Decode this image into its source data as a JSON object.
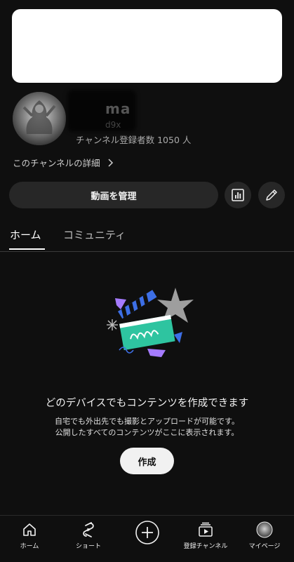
{
  "channel": {
    "name_partial": "ma",
    "handle_partial": "d9x",
    "subscribers": "チャンネル登録者数 1050 人",
    "details_link": "このチャンネルの詳細"
  },
  "actions": {
    "manage_label": "動画を管理",
    "analytics_icon": "analytics-icon",
    "edit_icon": "pencil-icon"
  },
  "tabs": [
    {
      "label": "ホーム",
      "active": true
    },
    {
      "label": "コミュニティ",
      "active": false
    }
  ],
  "empty_state": {
    "title": "どのデバイスでもコンテンツを作成できます",
    "line1": "自宅でも外出先でも撮影とアップロードが可能です。",
    "line2": "公開したすべてのコンテンツがここに表示されます。",
    "create_label": "作成"
  },
  "bottom_nav": [
    {
      "label": "ホーム",
      "icon": "home-icon"
    },
    {
      "label": "ショート",
      "icon": "shorts-icon"
    },
    {
      "label": "",
      "icon": "create-plus-icon"
    },
    {
      "label": "登録チャンネル",
      "icon": "subscriptions-icon"
    },
    {
      "label": "マイページ",
      "icon": "avatar"
    }
  ],
  "colors": {
    "background": "#0f0f0f",
    "button_dark": "#272727",
    "button_light": "#f1f1f1",
    "illustration_green": "#2ec4a0",
    "illustration_blue": "#3d6fe6",
    "illustration_purple": "#a57bff"
  }
}
